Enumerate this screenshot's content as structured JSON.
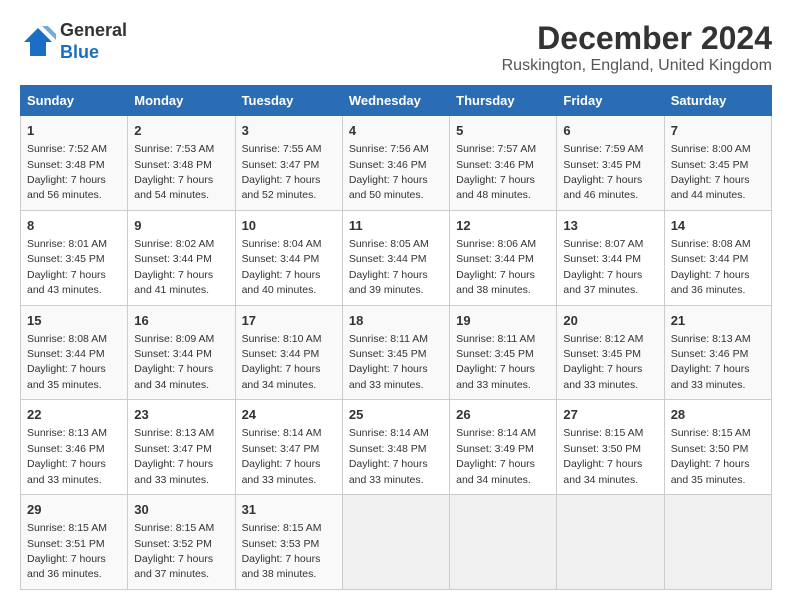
{
  "header": {
    "logo_line1": "General",
    "logo_line2": "Blue",
    "month": "December 2024",
    "location": "Ruskington, England, United Kingdom"
  },
  "weekdays": [
    "Sunday",
    "Monday",
    "Tuesday",
    "Wednesday",
    "Thursday",
    "Friday",
    "Saturday"
  ],
  "weeks": [
    [
      {
        "day": "1",
        "info": "Sunrise: 7:52 AM\nSunset: 3:48 PM\nDaylight: 7 hours and 56 minutes."
      },
      {
        "day": "2",
        "info": "Sunrise: 7:53 AM\nSunset: 3:48 PM\nDaylight: 7 hours and 54 minutes."
      },
      {
        "day": "3",
        "info": "Sunrise: 7:55 AM\nSunset: 3:47 PM\nDaylight: 7 hours and 52 minutes."
      },
      {
        "day": "4",
        "info": "Sunrise: 7:56 AM\nSunset: 3:46 PM\nDaylight: 7 hours and 50 minutes."
      },
      {
        "day": "5",
        "info": "Sunrise: 7:57 AM\nSunset: 3:46 PM\nDaylight: 7 hours and 48 minutes."
      },
      {
        "day": "6",
        "info": "Sunrise: 7:59 AM\nSunset: 3:45 PM\nDaylight: 7 hours and 46 minutes."
      },
      {
        "day": "7",
        "info": "Sunrise: 8:00 AM\nSunset: 3:45 PM\nDaylight: 7 hours and 44 minutes."
      }
    ],
    [
      {
        "day": "8",
        "info": "Sunrise: 8:01 AM\nSunset: 3:45 PM\nDaylight: 7 hours and 43 minutes."
      },
      {
        "day": "9",
        "info": "Sunrise: 8:02 AM\nSunset: 3:44 PM\nDaylight: 7 hours and 41 minutes."
      },
      {
        "day": "10",
        "info": "Sunrise: 8:04 AM\nSunset: 3:44 PM\nDaylight: 7 hours and 40 minutes."
      },
      {
        "day": "11",
        "info": "Sunrise: 8:05 AM\nSunset: 3:44 PM\nDaylight: 7 hours and 39 minutes."
      },
      {
        "day": "12",
        "info": "Sunrise: 8:06 AM\nSunset: 3:44 PM\nDaylight: 7 hours and 38 minutes."
      },
      {
        "day": "13",
        "info": "Sunrise: 8:07 AM\nSunset: 3:44 PM\nDaylight: 7 hours and 37 minutes."
      },
      {
        "day": "14",
        "info": "Sunrise: 8:08 AM\nSunset: 3:44 PM\nDaylight: 7 hours and 36 minutes."
      }
    ],
    [
      {
        "day": "15",
        "info": "Sunrise: 8:08 AM\nSunset: 3:44 PM\nDaylight: 7 hours and 35 minutes."
      },
      {
        "day": "16",
        "info": "Sunrise: 8:09 AM\nSunset: 3:44 PM\nDaylight: 7 hours and 34 minutes."
      },
      {
        "day": "17",
        "info": "Sunrise: 8:10 AM\nSunset: 3:44 PM\nDaylight: 7 hours and 34 minutes."
      },
      {
        "day": "18",
        "info": "Sunrise: 8:11 AM\nSunset: 3:45 PM\nDaylight: 7 hours and 33 minutes."
      },
      {
        "day": "19",
        "info": "Sunrise: 8:11 AM\nSunset: 3:45 PM\nDaylight: 7 hours and 33 minutes."
      },
      {
        "day": "20",
        "info": "Sunrise: 8:12 AM\nSunset: 3:45 PM\nDaylight: 7 hours and 33 minutes."
      },
      {
        "day": "21",
        "info": "Sunrise: 8:13 AM\nSunset: 3:46 PM\nDaylight: 7 hours and 33 minutes."
      }
    ],
    [
      {
        "day": "22",
        "info": "Sunrise: 8:13 AM\nSunset: 3:46 PM\nDaylight: 7 hours and 33 minutes."
      },
      {
        "day": "23",
        "info": "Sunrise: 8:13 AM\nSunset: 3:47 PM\nDaylight: 7 hours and 33 minutes."
      },
      {
        "day": "24",
        "info": "Sunrise: 8:14 AM\nSunset: 3:47 PM\nDaylight: 7 hours and 33 minutes."
      },
      {
        "day": "25",
        "info": "Sunrise: 8:14 AM\nSunset: 3:48 PM\nDaylight: 7 hours and 33 minutes."
      },
      {
        "day": "26",
        "info": "Sunrise: 8:14 AM\nSunset: 3:49 PM\nDaylight: 7 hours and 34 minutes."
      },
      {
        "day": "27",
        "info": "Sunrise: 8:15 AM\nSunset: 3:50 PM\nDaylight: 7 hours and 34 minutes."
      },
      {
        "day": "28",
        "info": "Sunrise: 8:15 AM\nSunset: 3:50 PM\nDaylight: 7 hours and 35 minutes."
      }
    ],
    [
      {
        "day": "29",
        "info": "Sunrise: 8:15 AM\nSunset: 3:51 PM\nDaylight: 7 hours and 36 minutes."
      },
      {
        "day": "30",
        "info": "Sunrise: 8:15 AM\nSunset: 3:52 PM\nDaylight: 7 hours and 37 minutes."
      },
      {
        "day": "31",
        "info": "Sunrise: 8:15 AM\nSunset: 3:53 PM\nDaylight: 7 hours and 38 minutes."
      },
      null,
      null,
      null,
      null
    ]
  ]
}
